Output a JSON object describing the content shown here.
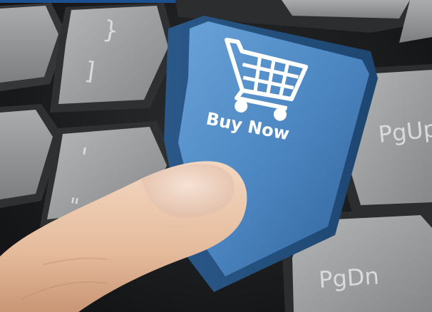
{
  "photo": {
    "subject": "Computer keyboard with blue shopping key pressed by a finger",
    "colors": {
      "key_gray": "#8f9192",
      "key_dark": "#3a3c3e",
      "buy_key": "#4d87c2",
      "buy_key_dark": "#2f6199",
      "finger": "#e8c4a8",
      "top_strip": "#1c4f8f"
    }
  },
  "buy_key": {
    "icon": "shopping-cart-icon",
    "label": "Buy Now"
  },
  "keys": {
    "brace": "}",
    "bracket": "]",
    "pgup": "PgUp",
    "pgdn": "PgDn",
    "apostrophe": "'",
    "quote": "\""
  }
}
